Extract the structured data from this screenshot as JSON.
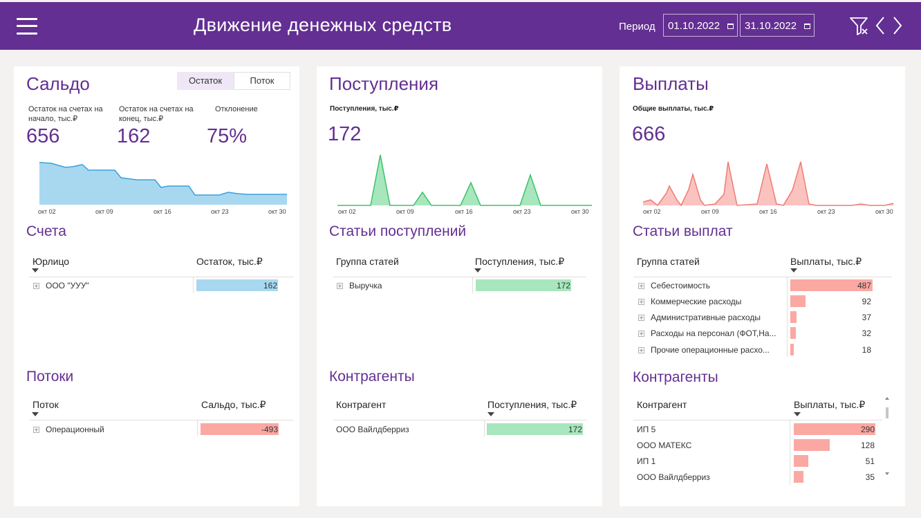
{
  "header": {
    "title": "Движение денежных средств",
    "period_label": "Период",
    "date_from": "01.10.2022",
    "date_to": "31.10.2022"
  },
  "saldo": {
    "title": "Сальдо",
    "toggle_active": "Остаток",
    "toggle_other": "Поток",
    "kpi1_label_line1": "Остаток на счетах на",
    "kpi1_label_line2": "начало, тыс.₽",
    "kpi1_value": "656",
    "kpi2_label_line1": "Остаток на счетах на",
    "kpi2_label_line2": "конец, тыс.₽",
    "kpi2_value": "162",
    "kpi3_label": "Отклонение",
    "kpi3_value": "75%",
    "axis": [
      "окт 02",
      "окт 09",
      "окт 16",
      "окт 23",
      "окт 30"
    ]
  },
  "inflows": {
    "title": "Поступления",
    "kpi_label": "Поступления, тыс.₽",
    "kpi_value": "172",
    "axis": [
      "окт 02",
      "окт 09",
      "окт 16",
      "окт 23",
      "окт 30"
    ]
  },
  "payouts": {
    "title": "Выплаты",
    "kpi_label": "Общие выплаты, тыс.₽",
    "kpi_value": "666",
    "axis": [
      "окт 02",
      "окт 09",
      "окт 16",
      "окт 23",
      "окт 30"
    ]
  },
  "accounts": {
    "title": "Счета",
    "col1": "Юрлицо",
    "col2": "Остаток, тыс.₽",
    "rows": [
      {
        "name": "ООО \"УУУ\"",
        "value": "162",
        "fraction": 1.0
      }
    ]
  },
  "inflow_items": {
    "title": "Статьи поступлений",
    "col1": "Группа статей",
    "col2": "Поступления, тыс.₽",
    "rows": [
      {
        "name": "Выручка",
        "value": "172",
        "fraction": 1.0
      }
    ]
  },
  "payout_items": {
    "title": "Статьи выплат",
    "col1": "Группа статей",
    "col2": "Выплаты, тыс.₽",
    "rows": [
      {
        "name": "Себестоимость",
        "value": "487",
        "fraction": 1.0
      },
      {
        "name": "Коммерческие расходы",
        "value": "92",
        "fraction": 0.19
      },
      {
        "name": "Административные расходы",
        "value": "37",
        "fraction": 0.076
      },
      {
        "name": "Расходы на персонал (ФОТ,На...",
        "value": "32",
        "fraction": 0.066
      },
      {
        "name": "Прочие операционные расхо...",
        "value": "18",
        "fraction": 0.037
      }
    ]
  },
  "flows": {
    "title": "Потоки",
    "col1": "Поток",
    "col2": "Сальдо, тыс.₽",
    "rows": [
      {
        "name": "Операционный",
        "value": "-493",
        "fraction": 1.0
      }
    ]
  },
  "inflow_counterparties": {
    "title": "Контрагенты",
    "col1": "Контрагент",
    "col2": "Поступления, тыс.₽",
    "rows": [
      {
        "name": "ООО Вайлдберриз",
        "value": "172",
        "fraction": 1.0
      }
    ]
  },
  "payout_counterparties": {
    "title": "Контрагенты",
    "col1": "Контрагент",
    "col2": "Выплаты, тыс.₽",
    "rows": [
      {
        "name": "ИП 5",
        "value": "290",
        "fraction": 1.0
      },
      {
        "name": "ООО МАТЕКС",
        "value": "128",
        "fraction": 0.44
      },
      {
        "name": "ИП 1",
        "value": "51",
        "fraction": 0.176
      },
      {
        "name": "ООО Вайлдберриз",
        "value": "35",
        "fraction": 0.12
      }
    ]
  },
  "colors": {
    "brand": "#632f92",
    "saldo_area": "#a8d8f0",
    "saldo_line": "#3a9fdc",
    "inflow_area": "#a8e6bd",
    "inflow_line": "#3cc16a",
    "payout_area": "#fbc3c0",
    "payout_line": "#f07a74",
    "neg_bar": "#fba8a3"
  },
  "icons": [
    "hamburger-icon",
    "filter-clear-icon",
    "chevron-left-icon",
    "chevron-right-icon",
    "calendar-icon",
    "expand-plus-icon",
    "sort-down-icon"
  ]
}
